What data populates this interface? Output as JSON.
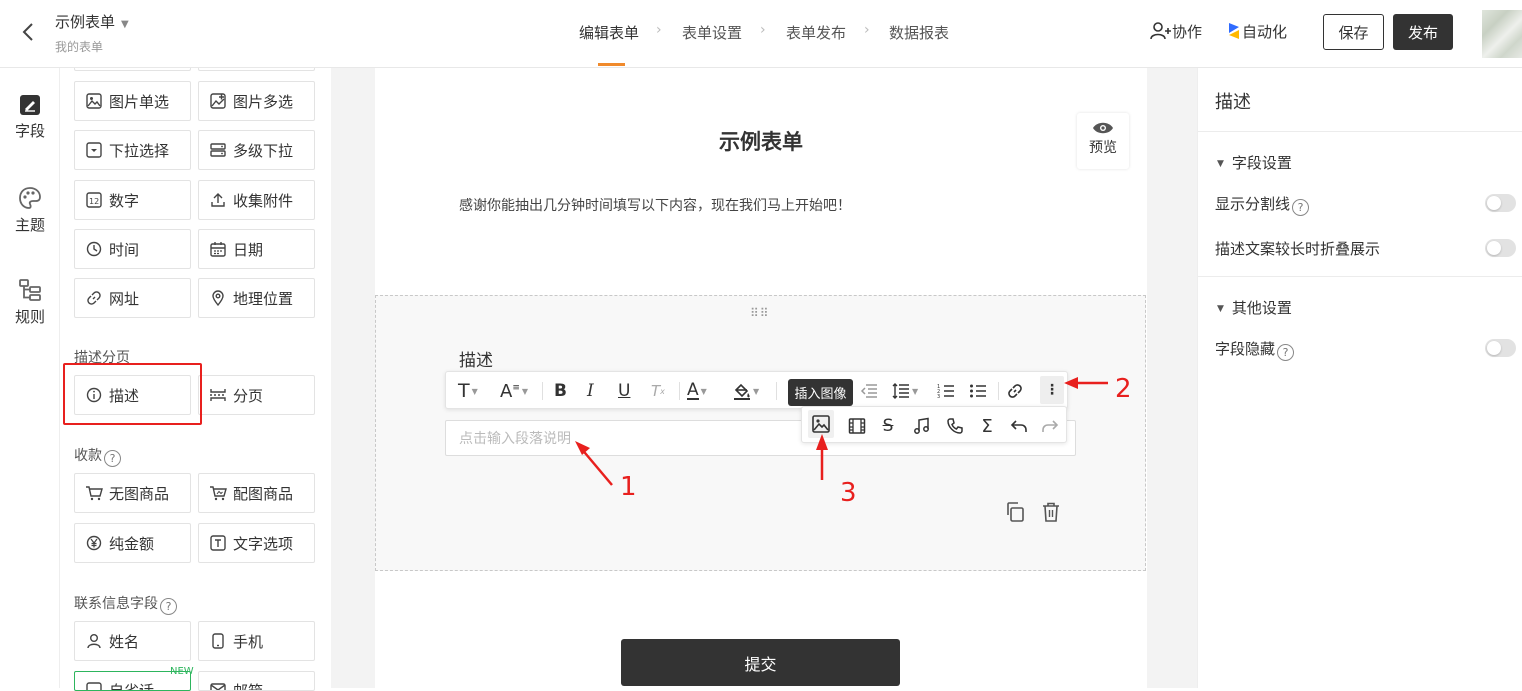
{
  "header": {
    "form_title": "示例表单",
    "form_subtitle": "我的表单",
    "steps": [
      "编辑表单",
      "表单设置",
      "表单发布",
      "数据报表"
    ],
    "collab_label": "协作",
    "auto_label": "自动化",
    "save_label": "保存",
    "publish_label": "发布",
    "accent_color": "#f08a2c"
  },
  "rail": {
    "items": [
      {
        "label": "字段",
        "icon": "field-icon"
      },
      {
        "label": "主题",
        "icon": "palette-icon"
      },
      {
        "label": "规则",
        "icon": "rules-icon"
      }
    ]
  },
  "palette": {
    "buttons": {
      "img_single": "图片单选",
      "img_multi": "图片多选",
      "dropdown": "下拉选择",
      "cascade": "多级下拉",
      "number": "数字",
      "attachment": "收集附件",
      "time": "时间",
      "date": "日期",
      "url": "网址",
      "location": "地理位置",
      "desc": "描述",
      "pagebreak": "分页",
      "no_img_goods": "无图商品",
      "img_goods": "配图商品",
      "pure_amount": "纯金额",
      "text_option": "文字选项",
      "name": "姓名",
      "phone": "手机",
      "custom": "自省话",
      "email": "邮箱"
    },
    "sections": {
      "desc_page": "描述分页",
      "payment": "收款",
      "contact": "联系信息字段"
    },
    "new_badge": "NEW"
  },
  "form": {
    "title": "示例表单",
    "preview_label": "预览",
    "description": "感谢你能抽出几分钟时间填写以下内容，现在我们马上开始吧！",
    "field_label": "描述",
    "input_placeholder": "点击输入段落说明",
    "tooltip": "插入图像",
    "submit_label": "提交"
  },
  "annotations": {
    "a1": "1",
    "a2": "2",
    "a3": "3",
    "color": "#e8201e"
  },
  "right_panel": {
    "title": "描述",
    "field_settings": "字段设置",
    "show_divider": "显示分割线",
    "collapse_long": "描述文案较长时折叠展示",
    "other_settings": "其他设置",
    "hide_field": "字段隐藏"
  }
}
